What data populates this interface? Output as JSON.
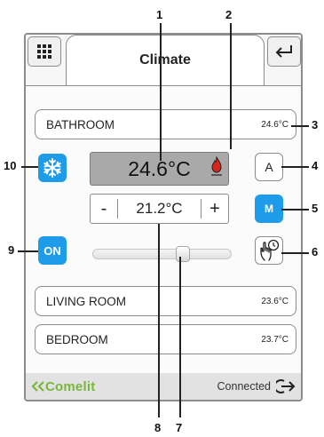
{
  "header": {
    "title": "Climate"
  },
  "current_zone": {
    "name": "BATHROOM",
    "temperature": "24.6°C"
  },
  "display": {
    "measured_temperature": "24.6°C"
  },
  "mode_buttons": {
    "auto_label": "A",
    "manual_label": "M"
  },
  "setpoint": {
    "minus": "-",
    "value": "21.2°C",
    "plus": "+"
  },
  "power": {
    "label": "ON"
  },
  "slider": {
    "level": 0.67
  },
  "other_zones": [
    {
      "name": "LIVING ROOM",
      "temperature": "23.6°C"
    },
    {
      "name": "BEDROOM",
      "temperature": "23.7°C"
    }
  ],
  "footer": {
    "brand": "Comelit",
    "status": "Connected"
  },
  "callouts": [
    "1",
    "2",
    "3",
    "4",
    "5",
    "6",
    "7",
    "8",
    "9",
    "10"
  ],
  "colors": {
    "accent_blue": "#1e9be9",
    "brand_green": "#79b63e",
    "flame_red": "#d9261c"
  },
  "icons": [
    "grid-icon",
    "return-icon",
    "snowflake-icon",
    "flame-icon",
    "hand-timer-icon",
    "logout-icon"
  ]
}
